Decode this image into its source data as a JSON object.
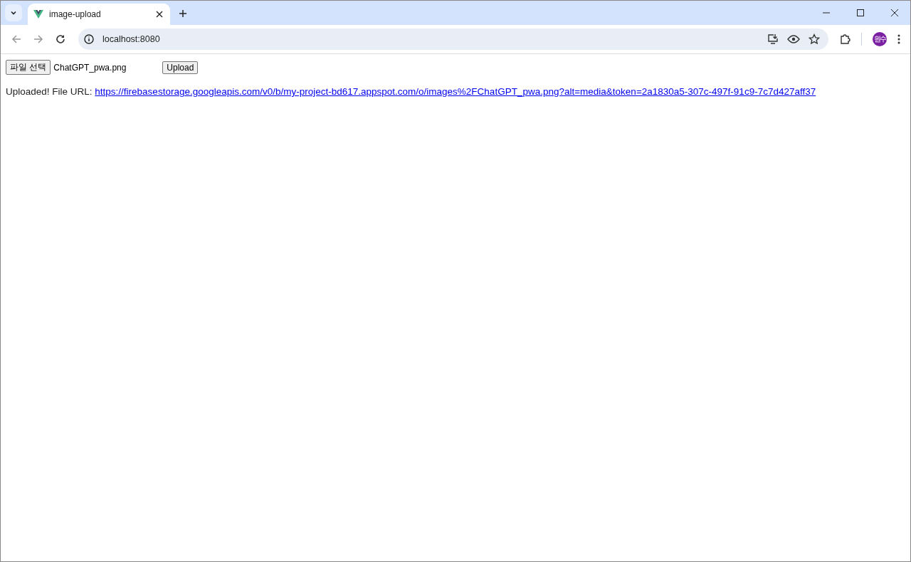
{
  "browser": {
    "tabs": [
      {
        "title": "image-upload",
        "selected": true
      }
    ],
    "address": "localhost:8080",
    "profile": "원수"
  },
  "page": {
    "file_button": "파일 선택",
    "file_name": "ChatGPT_pwa.png",
    "upload_button": "Upload",
    "message": "Uploaded! File URL:",
    "url": "https://firebasestorage.googleapis.com/v0/b/my-project-bd617.appspot.com/o/images%2FChatGPT_pwa.png?alt=media&token=2a1830a5-307c-497f-91c9-7c7d427aff37"
  }
}
